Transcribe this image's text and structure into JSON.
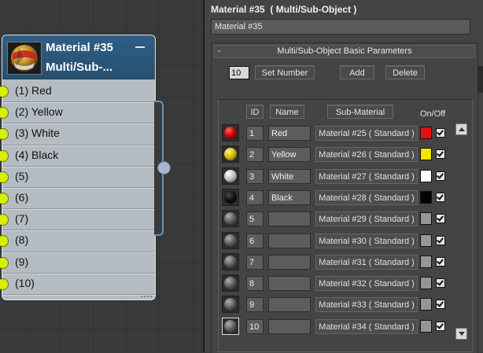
{
  "node": {
    "title": "Material #35",
    "subtitle": "Multi/Sub-...",
    "slots": [
      "(1) Red",
      "(2) Yellow",
      "(3) White",
      "(4) Black",
      "(5)",
      "(6)",
      "(7)",
      "(8)",
      "(9)",
      "(10)"
    ]
  },
  "panel": {
    "title": "Material #35  ( Multi/Sub-Object )",
    "name_value": "Material #35",
    "rollout_title": "Multi/Sub-Object Basic Parameters",
    "rollout_toggle": "-",
    "set_number_value": "10",
    "set_number_label": "Set Number",
    "add_label": "Add",
    "delete_label": "Delete",
    "headers": {
      "id": "ID",
      "name": "Name",
      "sub_material": "Sub-Material",
      "on_off": "On/Off"
    },
    "rows": [
      {
        "id": "1",
        "name": "Red",
        "sub": "Material #25  ( Standard )",
        "color": "#e8100c",
        "ball": "red"
      },
      {
        "id": "2",
        "name": "Yellow",
        "sub": "Material #26  ( Standard )",
        "color": "#f4e400",
        "ball": "yellow"
      },
      {
        "id": "3",
        "name": "White",
        "sub": "Material #27  ( Standard )",
        "color": "#ffffff",
        "ball": "white"
      },
      {
        "id": "4",
        "name": "Black",
        "sub": "Material #28  ( Standard )",
        "color": "#050505",
        "ball": "black"
      },
      {
        "id": "5",
        "name": "",
        "sub": "Material #29  ( Standard )",
        "color": "#969696",
        "ball": "gray"
      },
      {
        "id": "6",
        "name": "",
        "sub": "Material #30  ( Standard )",
        "color": "#969696",
        "ball": "gray"
      },
      {
        "id": "7",
        "name": "",
        "sub": "Material #31  ( Standard )",
        "color": "#969696",
        "ball": "gray"
      },
      {
        "id": "8",
        "name": "",
        "sub": "Material #32  ( Standard )",
        "color": "#969696",
        "ball": "gray"
      },
      {
        "id": "9",
        "name": "",
        "sub": "Material #33  ( Standard )",
        "color": "#969696",
        "ball": "gray"
      },
      {
        "id": "10",
        "name": "",
        "sub": "Material #34  ( Standard )",
        "color": "#969696",
        "ball": "gray"
      }
    ]
  }
}
